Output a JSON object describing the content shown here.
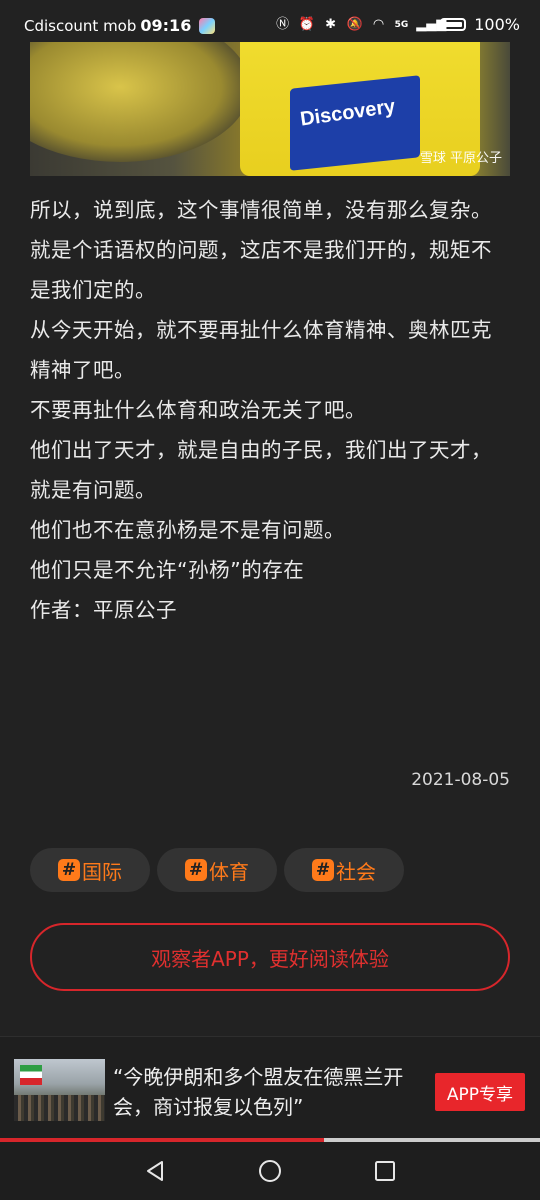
{
  "status_bar": {
    "app_name": "Cdiscount mob",
    "time": "09:16",
    "network": "5G",
    "battery": "100%"
  },
  "hero": {
    "jersey_text": "Discovery",
    "watermark": "雪球  平原公子"
  },
  "article": {
    "paragraphs": [
      "所以，说到底，这个事情很简单，没有那么复杂。",
      "就是个话语权的问题，这店不是我们开的，规矩不是我们定的。",
      "从今天开始，就不要再扯什么体育精神、奥林匹克精神了吧。",
      "不要再扯什么体育和政治无关了吧。",
      "他们出了天才，就是自由的子民，我们出了天才，就是有问题。",
      "他们也不在意孙杨是不是有问题。",
      "他们只是不允许“孙杨”的存在",
      "作者：平原公子"
    ],
    "date": "2021-08-05"
  },
  "tags": [
    {
      "hash": "#",
      "label": "国际"
    },
    {
      "hash": "#",
      "label": "体育"
    },
    {
      "hash": "#",
      "label": "社会"
    }
  ],
  "cta": {
    "label": "观察者APP，更好阅读体验"
  },
  "news_bar": {
    "headline": "“今晚伊朗和多个盟友在德黑兰开会，商讨报复以色列”",
    "button": "APP专享",
    "progress": 0.6
  },
  "colors": {
    "background": "#222222",
    "accent_orange": "#ff7a1a",
    "accent_red": "#d7262b"
  }
}
